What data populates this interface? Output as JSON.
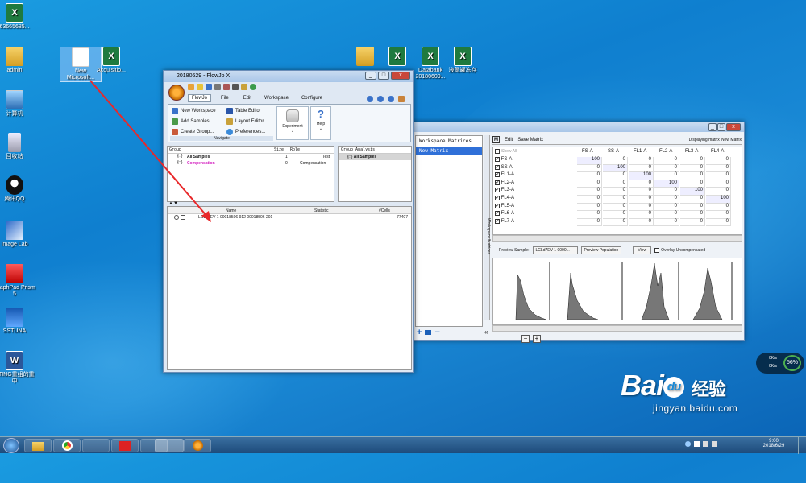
{
  "desktop": {
    "icons": [
      {
        "label": "63665685...",
        "kind": "xl"
      },
      {
        "label": "admin",
        "kind": "fold"
      },
      {
        "label": "计算机",
        "kind": "pc"
      },
      {
        "label": "回收站",
        "kind": "bin"
      },
      {
        "label": "腾讯QQ",
        "kind": "qq"
      },
      {
        "label": "Image Lab",
        "kind": "app"
      },
      {
        "label": "GraphPad Prism 5",
        "kind": "app2"
      },
      {
        "label": "SSTUNA",
        "kind": "app3"
      },
      {
        "label": "STING重组的重中",
        "kind": "word"
      },
      {
        "label": "New Microsoft...",
        "kind": "doc"
      },
      {
        "label": "Acquisitio...",
        "kind": "xl"
      },
      {
        "label": "",
        "kind": "fold"
      },
      {
        "label": "",
        "kind": "xl"
      },
      {
        "label": "Databank 20180609...",
        "kind": "xl"
      },
      {
        "label": "液氮罐冻存",
        "kind": "xl"
      }
    ]
  },
  "flowjo": {
    "title": "20180629 - FlowJo X",
    "tabs": [
      "FlowJo",
      "File",
      "Edit",
      "Workspace",
      "Configure"
    ],
    "ribbon": {
      "new_workspace": "New Workspace",
      "add_samples": "Add Samples...",
      "create_group": "Create Group...",
      "table_editor": "Table Editor",
      "layout_editor": "Layout Editor",
      "preferences": "Preferences...",
      "navigate": "Navigate",
      "experiment": "Experiment",
      "help": "Help"
    },
    "group_headers": {
      "group": "Group",
      "size": "Size",
      "role": "Role",
      "analysis": "Group Analysis"
    },
    "groups": [
      {
        "name": "All Samples",
        "size": "1",
        "role": "Test"
      },
      {
        "name": "Compensation",
        "size": "0",
        "role": "Compensation"
      }
    ],
    "analysis_item": "All Samples",
    "sample_headers": {
      "name": "Name",
      "statistic": "Statistic",
      "cells": "#Cells"
    },
    "sample": {
      "name": "LCL67EV-1 00018506 912 00018506 201",
      "cells": "77407"
    }
  },
  "matrix": {
    "list_header": "Workspace Matrices",
    "list_item": "New Matrix",
    "side_label": "Workspace Matrices",
    "toolbar": {
      "edit": "Edit",
      "save": "Save Matrix",
      "displaying": "Displaying matrix 'New Matrix'"
    },
    "show_all": "Show All",
    "columns": [
      "FS-A",
      "SS-A",
      "FL1-A",
      "FL2-A",
      "FL3-A",
      "FL4-A"
    ],
    "rows": [
      {
        "name": "FS-A",
        "vals": [
          "100",
          "0",
          "0",
          "0",
          "0",
          "0"
        ]
      },
      {
        "name": "SS-A",
        "vals": [
          "0",
          "100",
          "0",
          "0",
          "0",
          "0"
        ]
      },
      {
        "name": "FL1-A",
        "vals": [
          "0",
          "0",
          "100",
          "0",
          "0",
          "0"
        ]
      },
      {
        "name": "FL2-A",
        "vals": [
          "0",
          "0",
          "0",
          "100",
          "0",
          "0"
        ]
      },
      {
        "name": "FL3-A",
        "vals": [
          "0",
          "0",
          "0",
          "0",
          "100",
          "0"
        ]
      },
      {
        "name": "FL4-A",
        "vals": [
          "0",
          "0",
          "0",
          "0",
          "0",
          "100"
        ]
      },
      {
        "name": "FL5-A",
        "vals": [
          "0",
          "0",
          "0",
          "0",
          "0",
          "0"
        ]
      },
      {
        "name": "FL6-A",
        "vals": [
          "0",
          "0",
          "0",
          "0",
          "0",
          "0"
        ]
      },
      {
        "name": "FL7-A",
        "vals": [
          "0",
          "0",
          "0",
          "0",
          "0",
          "0"
        ]
      }
    ],
    "preview_sample_label": "Preview Sample:",
    "preview_sample_value": "LCLd7EV-1 0000...",
    "preview_population": "Preview Population",
    "view": "View",
    "overlay": "Overlay Uncompensated"
  },
  "tray": {
    "time": "9:00",
    "date": "2018/6/29",
    "net_up": "0K/s",
    "net_down": "0K/s",
    "percent": "56%"
  },
  "watermark": {
    "brand": "Bai",
    "brand2": "百",
    "cn": "经验",
    "url": "jingyan.baidu.com"
  }
}
